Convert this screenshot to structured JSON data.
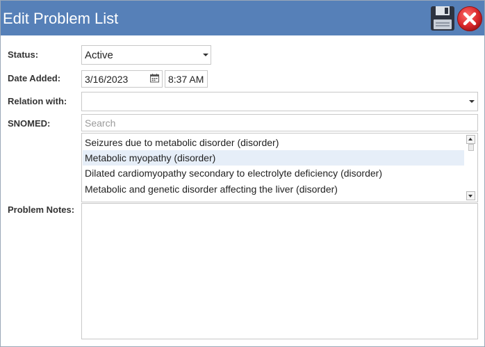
{
  "window": {
    "title": "Edit Problem List",
    "header_color": "#5680b8"
  },
  "toolbar": {
    "save_icon": "floppy-disk-save-icon",
    "close_icon": "red-circle-x-close-icon"
  },
  "form": {
    "status": {
      "label": "Status:",
      "value": "Active"
    },
    "date_added": {
      "label": "Date Added:",
      "date": "3/16/2023",
      "time": "8:37 AM"
    },
    "relation_with": {
      "label": "Relation with:",
      "value": ""
    },
    "snomed": {
      "label": "SNOMED:",
      "search_placeholder": "Search",
      "results": [
        {
          "text": "Seizures due to metabolic disorder (disorder)",
          "selected": false
        },
        {
          "text": "Metabolic myopathy (disorder)",
          "selected": true
        },
        {
          "text": "Dilated cardiomyopathy secondary to electrolyte deficiency (disorder)",
          "selected": false
        },
        {
          "text": "Metabolic and genetic disorder affecting the liver (disorder)",
          "selected": false
        }
      ]
    },
    "problem_notes": {
      "label": "Problem Notes:",
      "value": ""
    }
  }
}
